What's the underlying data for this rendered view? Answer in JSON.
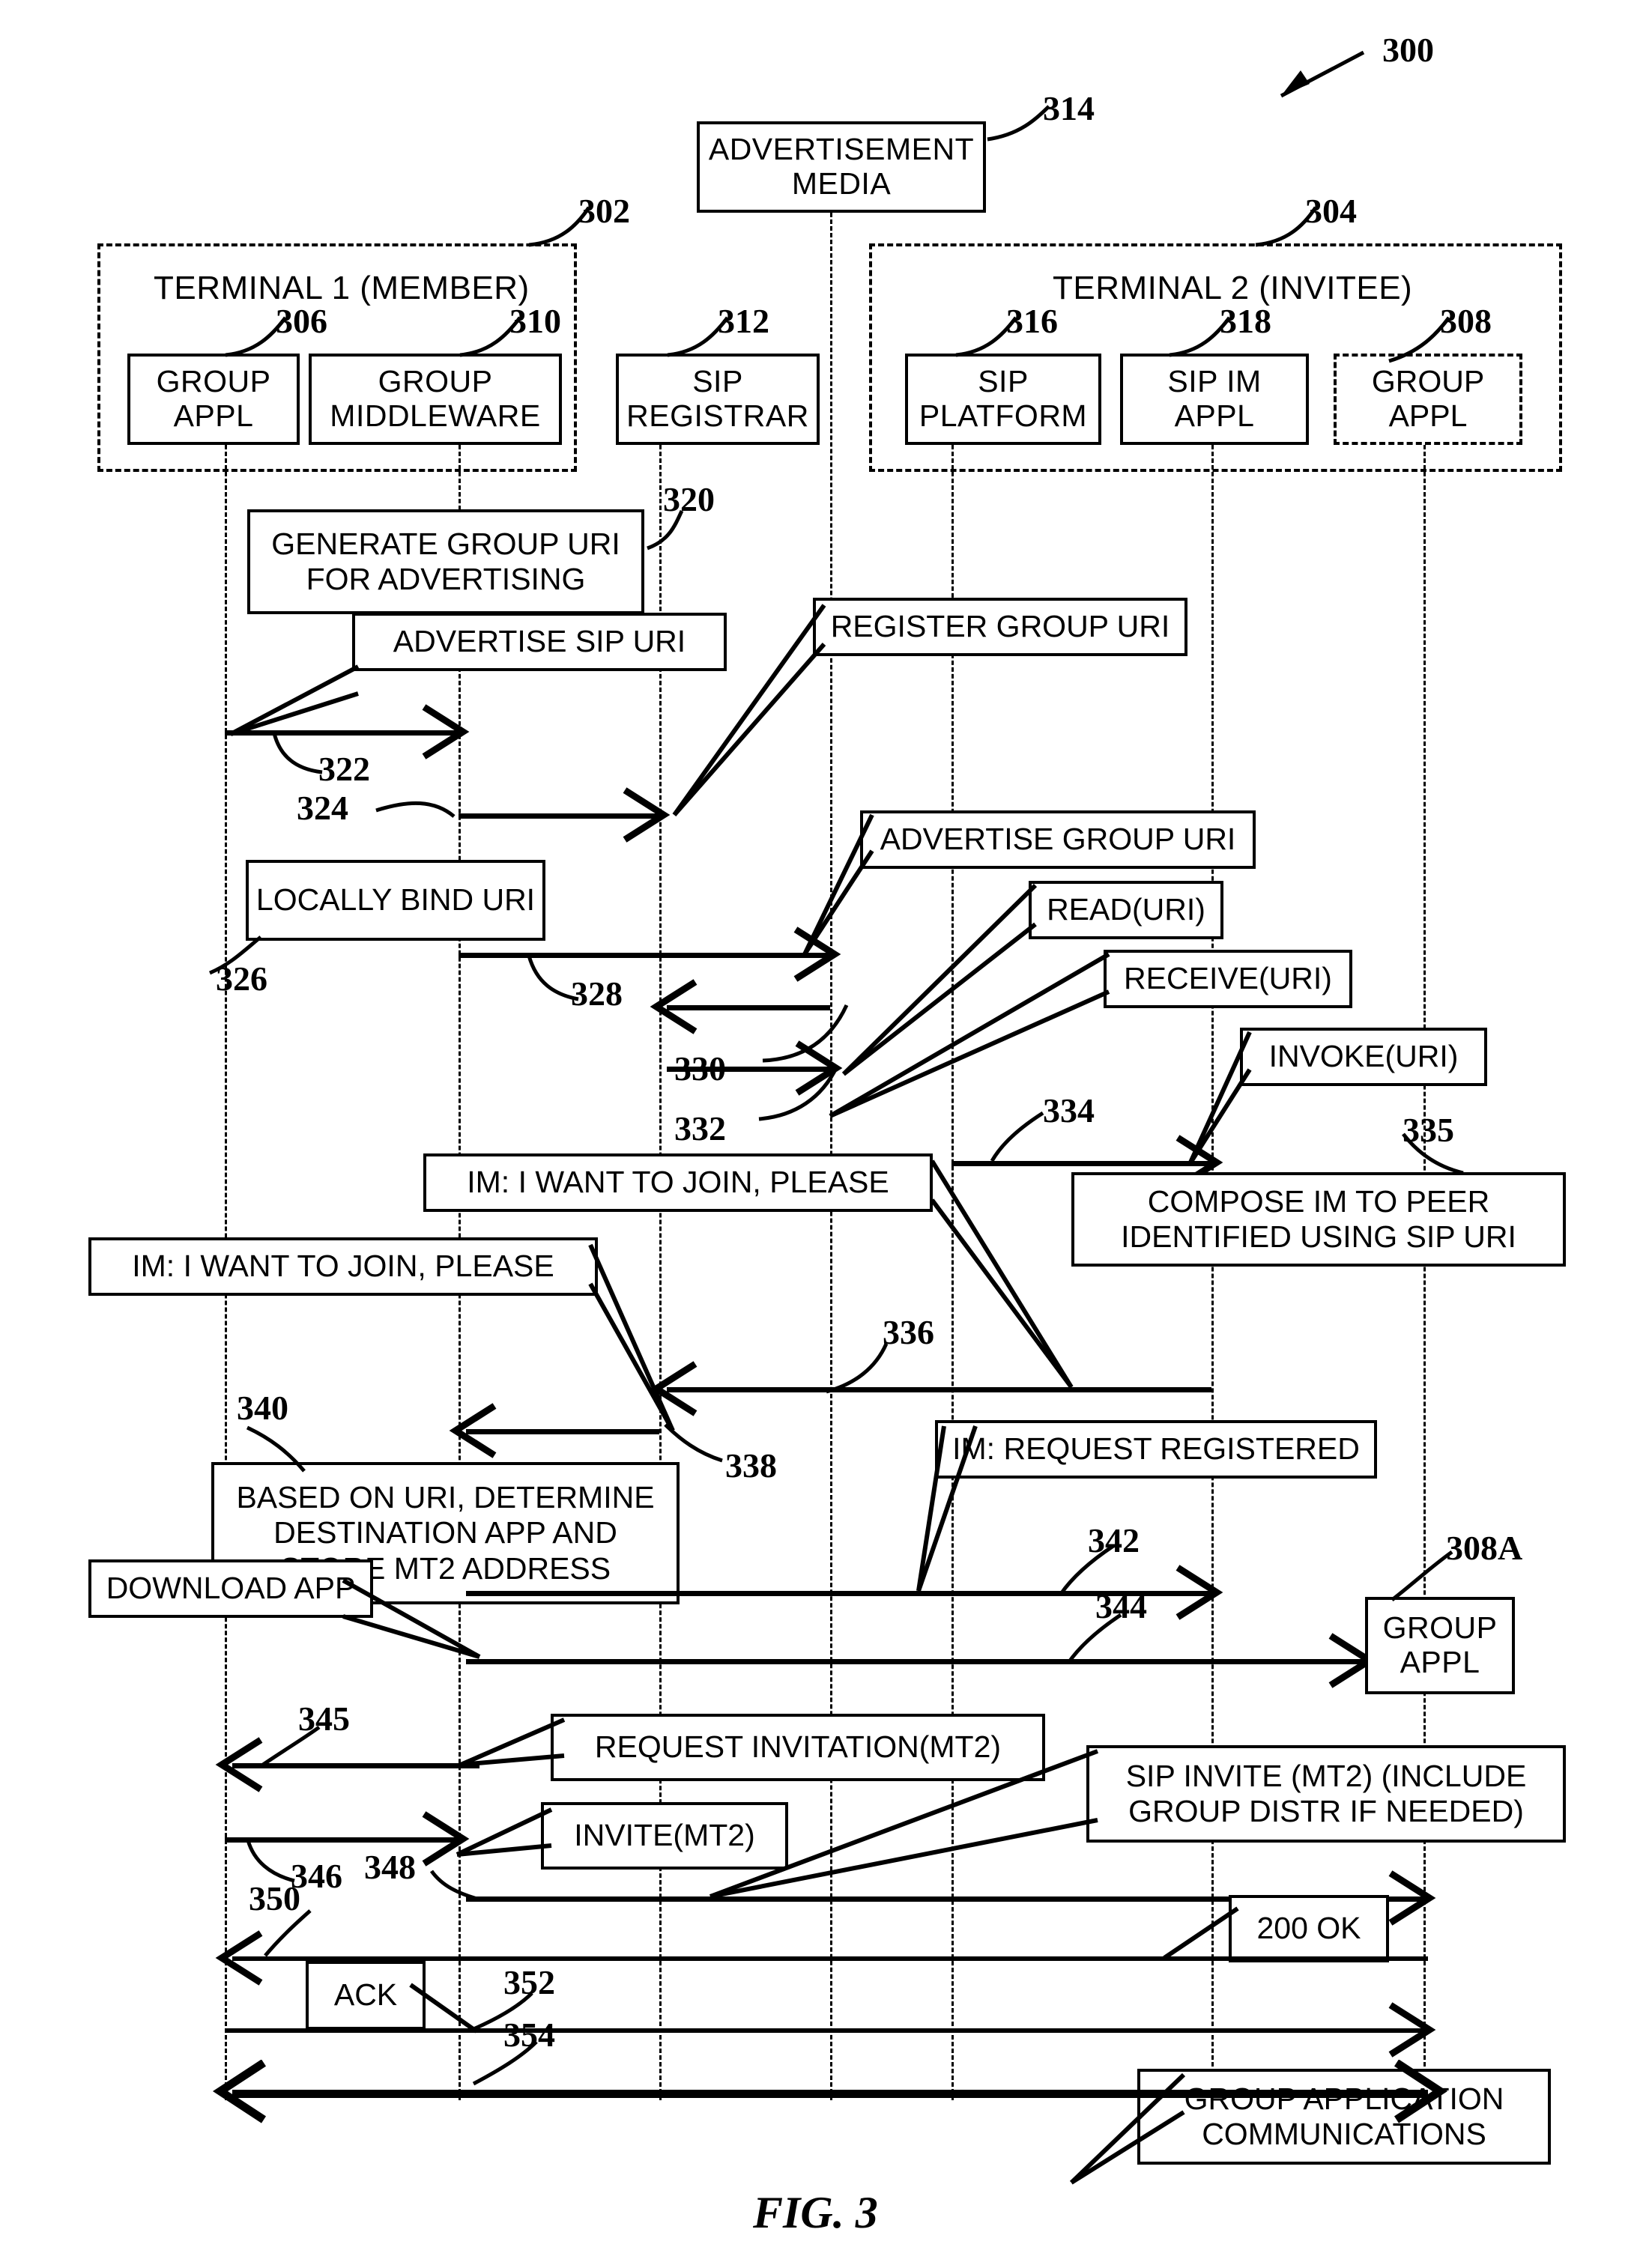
{
  "figure": {
    "caption": "FIG. 3",
    "ref_main": "300"
  },
  "containers": [
    {
      "ref": "302",
      "title": "TERMINAL 1 (MEMBER)"
    },
    {
      "ref": "304",
      "title": "TERMINAL 2 (INVITEE)"
    }
  ],
  "lifelines": [
    {
      "ref": "306",
      "label_line1": "GROUP",
      "label_line2": "APPL",
      "name": "group-appl-terminal1"
    },
    {
      "ref": "310",
      "label_line1": "GROUP",
      "label_line2": "MIDDLEWARE",
      "name": "group-middleware"
    },
    {
      "ref": "312",
      "label_line1": "SIP",
      "label_line2": "REGISTRAR",
      "name": "sip-registrar"
    },
    {
      "ref": "314",
      "label_line1": "ADVERTISEMENT",
      "label_line2": "MEDIA",
      "name": "advertisement-media"
    },
    {
      "ref": "316",
      "label_line1": "SIP",
      "label_line2": "PLATFORM",
      "name": "sip-platform"
    },
    {
      "ref": "318",
      "label_line1": "SIP IM",
      "label_line2": "APPL",
      "name": "sip-im-appl"
    },
    {
      "ref": "308",
      "label_line1": "GROUP",
      "label_line2": "APPL",
      "name": "group-appl-terminal2"
    }
  ],
  "process_notes": [
    {
      "ref": "320",
      "lines": [
        "GENERATE GROUP URI",
        "FOR ADVERTISING"
      ]
    },
    {
      "ref": "326",
      "lines": [
        "LOCALLY BIND URI"
      ]
    },
    {
      "ref": "335",
      "lines": [
        "COMPOSE IM TO PEER",
        "IDENTIFIED USING SIP URI"
      ]
    },
    {
      "ref": "340",
      "lines": [
        "BASED ON URI, DETERMINE",
        "DESTINATION APP AND",
        "STORE MT2 ADDRESS"
      ]
    }
  ],
  "messages": [
    {
      "ref": "322",
      "label": "ADVERTISE SIP URI"
    },
    {
      "ref": "324",
      "label": "REGISTER GROUP URI"
    },
    {
      "ref": "328",
      "label": "ADVERTISE GROUP URI"
    },
    {
      "ref": "330",
      "label": "READ(URI)"
    },
    {
      "ref": "332",
      "label": "RECEIVE(URI)"
    },
    {
      "ref": "334",
      "label": "INVOKE(URI)"
    },
    {
      "ref": "336",
      "label": "IM: I WANT TO JOIN, PLEASE"
    },
    {
      "ref": "338",
      "label": "IM: I WANT TO JOIN, PLEASE"
    },
    {
      "ref": "342",
      "label": "IM:  REQUEST REGISTERED"
    },
    {
      "ref": "344",
      "label": "DOWNLOAD APP"
    },
    {
      "ref": "345",
      "label": "REQUEST INVITATION(MT2)"
    },
    {
      "ref": "346",
      "label": "INVITE(MT2)"
    },
    {
      "ref": "348",
      "label": "SIP INVITE (MT2) (INCLUDE GROUP DISTR IF NEEDED)"
    },
    {
      "ref": "350",
      "label": "200 OK"
    },
    {
      "ref": "352",
      "label": "ACK"
    },
    {
      "ref": "354",
      "label": "GROUP APPLICATION COMMUNICATIONS"
    }
  ],
  "callout_boxes": {
    "advertisement_media": {
      "line1": "ADVERTISEMENT",
      "line2": "MEDIA"
    },
    "group_appl_308a": {
      "ref": "308A",
      "line1": "GROUP",
      "line2": "APPL"
    },
    "advertise_sip_uri": "ADVERTISE SIP URI",
    "register_group_uri": "REGISTER GROUP URI",
    "advertise_group_uri": "ADVERTISE GROUP URI",
    "read_uri": "READ(URI)",
    "receive_uri": "RECEIVE(URI)",
    "invoke_uri": "INVOKE(URI)",
    "im_join_1": "IM: I WANT TO JOIN, PLEASE",
    "im_join_2": "IM: I WANT TO JOIN, PLEASE",
    "im_request_registered": "IM:  REQUEST REGISTERED",
    "download_app": "DOWNLOAD APP",
    "request_invitation": "REQUEST INVITATION(MT2)",
    "invite_mt2": "INVITE(MT2)",
    "sip_invite_l1": "SIP INVITE (MT2) (INCLUDE",
    "sip_invite_l2": "GROUP DISTR IF NEEDED)",
    "ok_200": "200 OK",
    "ack": "ACK",
    "group_comm_l1": "GROUP APPLICATION",
    "group_comm_l2": "COMMUNICATIONS"
  },
  "refs": {
    "r300": "300",
    "r302": "302",
    "r304": "304",
    "r306": "306",
    "r308": "308",
    "r308A": "308A",
    "r310": "310",
    "r312": "312",
    "r314": "314",
    "r316": "316",
    "r318": "318",
    "r320": "320",
    "r322": "322",
    "r324": "324",
    "r326": "326",
    "r328": "328",
    "r330": "330",
    "r332": "332",
    "r334": "334",
    "r335": "335",
    "r336": "336",
    "r338": "338",
    "r340": "340",
    "r342": "342",
    "r344": "344",
    "r345": "345",
    "r346": "346",
    "r348": "348",
    "r350": "350",
    "r352": "352",
    "r354": "354"
  },
  "colors": {
    "ink": "#000000",
    "paper": "#ffffff"
  }
}
